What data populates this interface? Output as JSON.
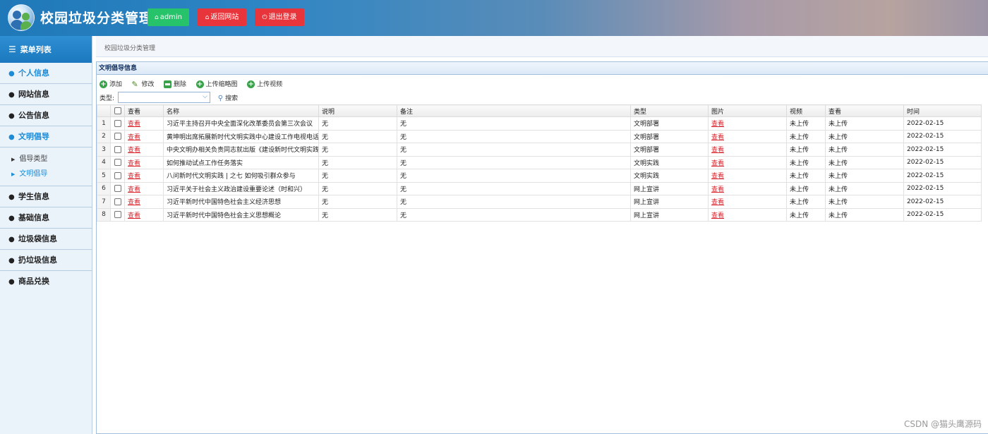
{
  "header": {
    "title": "校园垃圾分类管理",
    "buttons": [
      {
        "label": "admin",
        "icon": "home-icon",
        "color": "#27c36a"
      },
      {
        "label": "返回网站",
        "icon": "home-icon",
        "color": "#e8343b"
      },
      {
        "label": "退出登录",
        "icon": "power-icon",
        "color": "#e8343b"
      }
    ]
  },
  "sidebar": {
    "heading": "菜单列表",
    "items": [
      {
        "label": "个人信息",
        "icon": "user-icon",
        "active": true
      },
      {
        "label": "网站信息",
        "icon": "user-icon"
      },
      {
        "label": "公告信息",
        "icon": "user-icon"
      },
      {
        "label": "文明倡导",
        "icon": "user-icon",
        "active": true
      },
      {
        "label": "学生信息",
        "icon": "user-icon"
      },
      {
        "label": "基础信息",
        "icon": "user-icon"
      },
      {
        "label": "垃圾袋信息",
        "icon": "user-icon"
      },
      {
        "label": "扔垃圾信息",
        "icon": "user-icon"
      },
      {
        "label": "商品兑换",
        "icon": "user-icon"
      }
    ],
    "subitems": [
      {
        "label": "倡导类型"
      },
      {
        "label": "文明倡导",
        "active": true
      }
    ]
  },
  "breadcrumb": "校园垃圾分类管理",
  "panel": {
    "title": "文明倡导信息",
    "toolbar": {
      "add": "添加",
      "edit": "修改",
      "delete": "删除",
      "upload_thumb": "上传缩略图",
      "upload_video": "上传视频"
    },
    "filter": {
      "label": "类型:",
      "value": "",
      "search": "搜索"
    }
  },
  "table": {
    "columns": [
      "查看",
      "名称",
      "说明",
      "备注",
      "类型",
      "图片",
      "视频",
      "查看",
      "时间"
    ],
    "rows": [
      {
        "no": "1",
        "view": "查看",
        "name": "习近平主持召开中央全面深化改革委员会第三次会议",
        "desc": "无",
        "note": "无",
        "type": "文明部署",
        "pic": "查看",
        "video": "未上传",
        "view2": "未上传",
        "time": "2022-02-15"
      },
      {
        "no": "2",
        "view": "查看",
        "name": "黄坤明出席拓展新时代文明实践中心建设工作电视电话会议",
        "desc": "无",
        "note": "无",
        "type": "文明部署",
        "pic": "查看",
        "video": "未上传",
        "view2": "未上传",
        "time": "2022-02-15"
      },
      {
        "no": "3",
        "view": "查看",
        "name": "中央文明办相关负责同志就出版《建设新时代文明实践中心",
        "desc": "无",
        "note": "无",
        "type": "文明部署",
        "pic": "查看",
        "video": "未上传",
        "view2": "未上传",
        "time": "2022-02-15"
      },
      {
        "no": "4",
        "view": "查看",
        "name": "如何推动试点工作任务落实",
        "desc": "无",
        "note": "无",
        "type": "文明实践",
        "pic": "查看",
        "video": "未上传",
        "view2": "未上传",
        "time": "2022-02-15"
      },
      {
        "no": "5",
        "view": "查看",
        "name": "八问新时代文明实践 | 之七 如何吸引群众参与",
        "desc": "无",
        "note": "无",
        "type": "文明实践",
        "pic": "查看",
        "video": "未上传",
        "view2": "未上传",
        "time": "2022-02-15"
      },
      {
        "no": "6",
        "view": "查看",
        "name": "习近平关于社会主义政治建设重要论述（时和兴）",
        "desc": "无",
        "note": "无",
        "type": "网上宣讲",
        "pic": "查看",
        "video": "未上传",
        "view2": "未上传",
        "time": "2022-02-15"
      },
      {
        "no": "7",
        "view": "查看",
        "name": "习近平新时代中国特色社会主义经济思想",
        "desc": "无",
        "note": "无",
        "type": "网上宣讲",
        "pic": "查看",
        "video": "未上传",
        "view2": "未上传",
        "time": "2022-02-15"
      },
      {
        "no": "8",
        "view": "查看",
        "name": "习近平新时代中国特色社会主义思想概论",
        "desc": "无",
        "note": "无",
        "type": "网上宣讲",
        "pic": "查看",
        "video": "未上传",
        "view2": "未上传",
        "time": "2022-02-15"
      }
    ]
  },
  "watermark": "CSDN @猫头鹰源码",
  "colors": {
    "accent": "#1c8cd6",
    "link": "#d8262e",
    "header_green": "#27c36a",
    "header_red": "#e8343b"
  }
}
